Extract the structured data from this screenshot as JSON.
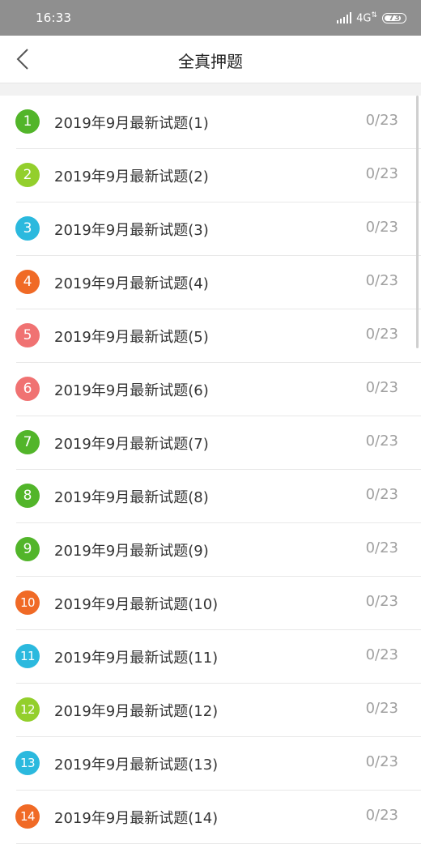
{
  "status_bar": {
    "time": "16:33",
    "network": "4G",
    "battery": "73"
  },
  "header": {
    "title": "全真押题",
    "back_icon": "chevron-left-icon"
  },
  "items": [
    {
      "number": "1",
      "title": "2019年9月最新试题(1)",
      "progress": "0/23",
      "color": "#52b52a"
    },
    {
      "number": "2",
      "title": "2019年9月最新试题(2)",
      "progress": "0/23",
      "color": "#93cf2c"
    },
    {
      "number": "3",
      "title": "2019年9月最新试题(3)",
      "progress": "0/23",
      "color": "#2bb9de"
    },
    {
      "number": "4",
      "title": "2019年9月最新试题(4)",
      "progress": "0/23",
      "color": "#f06a26"
    },
    {
      "number": "5",
      "title": "2019年9月最新试题(5)",
      "progress": "0/23",
      "color": "#f07272"
    },
    {
      "number": "6",
      "title": "2019年9月最新试题(6)",
      "progress": "0/23",
      "color": "#f07272"
    },
    {
      "number": "7",
      "title": "2019年9月最新试题(7)",
      "progress": "0/23",
      "color": "#52b52a"
    },
    {
      "number": "8",
      "title": "2019年9月最新试题(8)",
      "progress": "0/23",
      "color": "#52b52a"
    },
    {
      "number": "9",
      "title": "2019年9月最新试题(9)",
      "progress": "0/23",
      "color": "#52b52a"
    },
    {
      "number": "10",
      "title": "2019年9月最新试题(10)",
      "progress": "0/23",
      "color": "#f06a26"
    },
    {
      "number": "11",
      "title": "2019年9月最新试题(11)",
      "progress": "0/23",
      "color": "#2bb9de"
    },
    {
      "number": "12",
      "title": "2019年9月最新试题(12)",
      "progress": "0/23",
      "color": "#93cf2c"
    },
    {
      "number": "13",
      "title": "2019年9月最新试题(13)",
      "progress": "0/23",
      "color": "#2bb9de"
    },
    {
      "number": "14",
      "title": "2019年9月最新试题(14)",
      "progress": "0/23",
      "color": "#f06a26"
    }
  ]
}
